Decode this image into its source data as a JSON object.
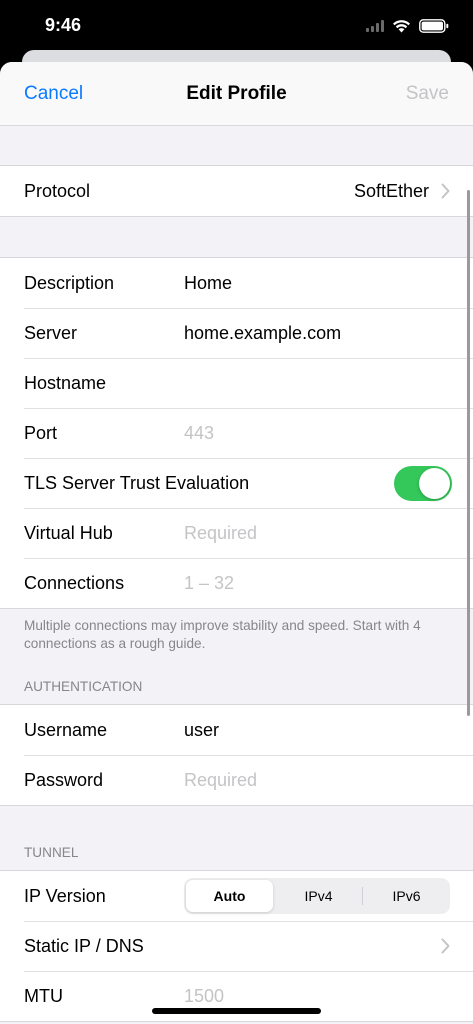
{
  "status": {
    "time": "9:46"
  },
  "nav": {
    "cancel": "Cancel",
    "title": "Edit Profile",
    "save": "Save"
  },
  "protocol": {
    "label": "Protocol",
    "value": "SoftEther"
  },
  "profile": {
    "description_label": "Description",
    "description_value": "Home",
    "server_label": "Server",
    "server_value": "home.example.com",
    "hostname_label": "Hostname",
    "hostname_value": "",
    "port_label": "Port",
    "port_placeholder": "443",
    "tls_label": "TLS Server Trust Evaluation",
    "tls_enabled": true,
    "hub_label": "Virtual Hub",
    "hub_placeholder": "Required",
    "connections_label": "Connections",
    "connections_placeholder": "1 – 32",
    "footer": "Multiple connections may improve stability and speed. Start with 4 connections as a rough guide."
  },
  "authentication": {
    "header": "AUTHENTICATION",
    "username_label": "Username",
    "username_value": "user",
    "password_label": "Password",
    "password_placeholder": "Required"
  },
  "tunnel": {
    "header": "TUNNEL",
    "ip_version_label": "IP Version",
    "ip_options": [
      "Auto",
      "IPv4",
      "IPv6"
    ],
    "ip_selected": "Auto",
    "static_label": "Static IP / DNS",
    "mtu_label": "MTU",
    "mtu_placeholder": "1500"
  },
  "colors": {
    "accent": "#0a7aff",
    "toggle_on": "#34c759",
    "placeholder": "#c4c4c7"
  },
  "icons": [
    "wifi-icon",
    "battery-icon",
    "signal-icon",
    "chevron-right-icon"
  ]
}
